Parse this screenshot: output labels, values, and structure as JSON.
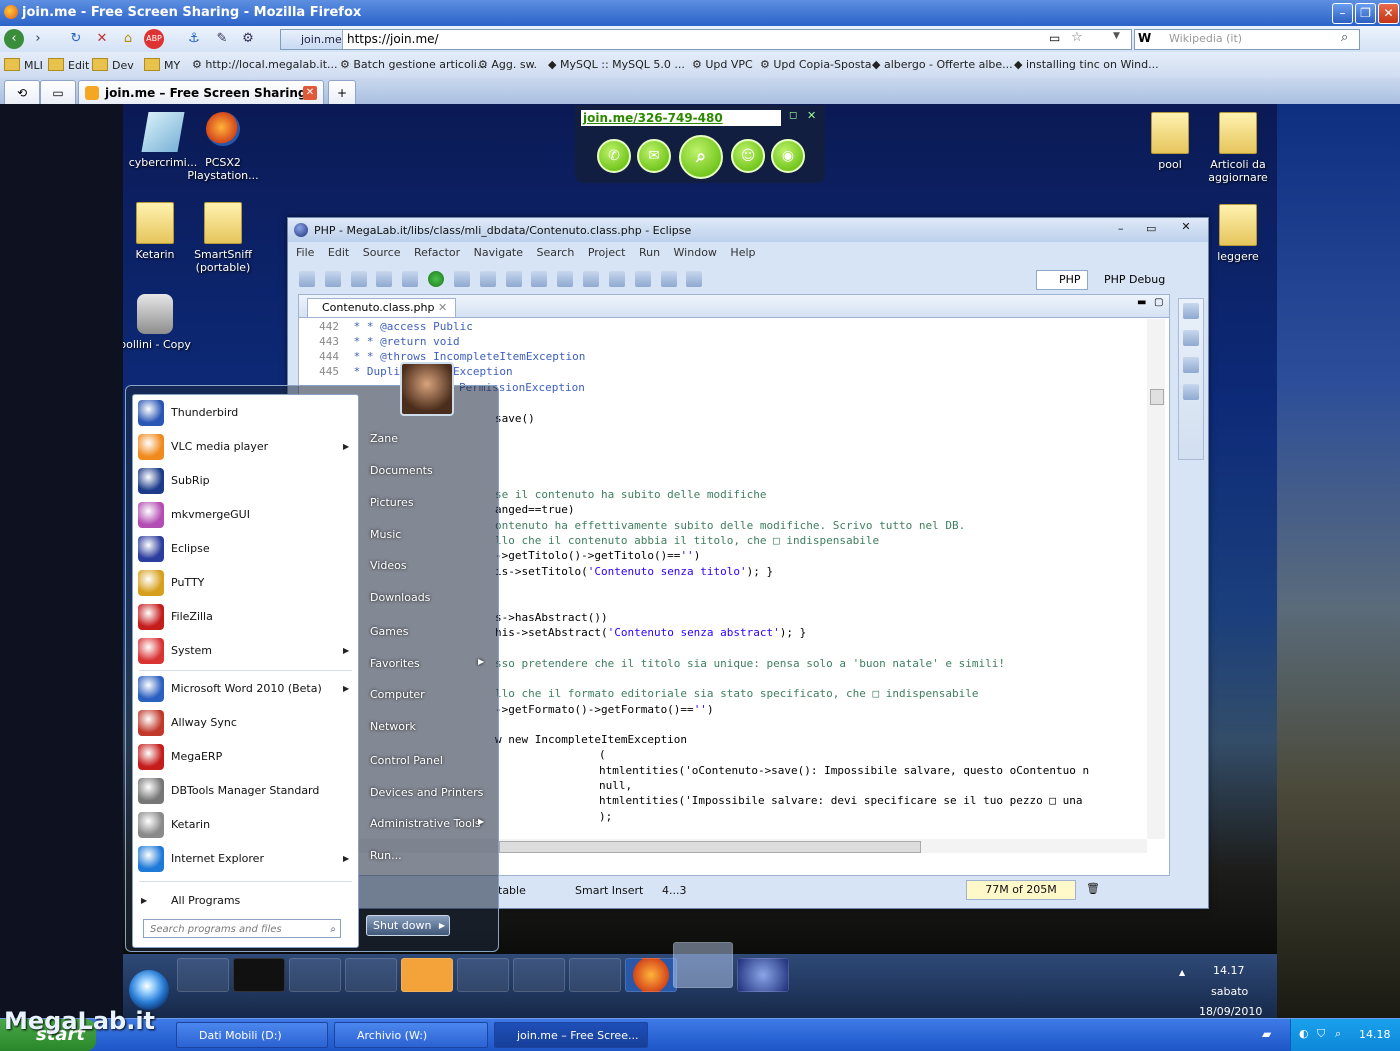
{
  "firefox": {
    "title": "join.me - Free Screen Sharing - Mozilla Firefox",
    "url_site": "join.me",
    "url": "https://join.me/",
    "search_placeholder": "Wikipedia (it)",
    "bookmarks": [
      "MLI",
      "Edit",
      "Dev",
      "MY",
      "http://local.megalab.it...",
      "Batch gestione articoli...",
      "Agg. sw.",
      "MySQL :: MySQL 5.0 ...",
      "Upd VPC",
      "Upd Copia-Sposta",
      "albergo - Offerte albe...",
      "installing tinc on Wind..."
    ],
    "tab_label": "join.me – Free Screen Sharing"
  },
  "joinme": {
    "code_url": "join.me/326-749-480"
  },
  "desktop_icons": {
    "cybercrimi": "cybercrimi...",
    "pcsx2": "PCSX2 Playstation...",
    "ketarin": "Ketarin",
    "smartsniff": "SmartSniff (portable)",
    "bollini": "bollini - Copy",
    "pool": "pool",
    "articoli": "Articoli da aggiornare",
    "leggere": "leggere"
  },
  "eclipse": {
    "title": "PHP - MegaLab.it/libs/class/mli_dbdata/Contenuto.class.php - Eclipse",
    "menu": [
      "File",
      "Edit",
      "Source",
      "Refactor",
      "Navigate",
      "Search",
      "Project",
      "Run",
      "Window",
      "Help"
    ],
    "perspective_php": "PHP",
    "perspective_debug": "PHP Debug",
    "editor_tab": "Contenuto.class.php",
    "code_lines": [
      {
        "n": "442",
        "text": "* @access Public"
      },
      {
        "n": "443",
        "text": "* @return void"
      },
      {
        "n": "444",
        "text": "* @throws IncompleteItemException"
      },
      {
        "n": "445",
        "text": "DuplicateItemException"
      },
      {
        "n": "",
        "text": "PermissionException"
      },
      {
        "n": "",
        "text": "save()"
      },
      {
        "n": "",
        "text": "se il contenuto ha subito delle modifiche"
      },
      {
        "n": "",
        "text": "anged==true)"
      },
      {
        "n": "",
        "text": "ontenuto ha effettivamente subito delle modifiche. Scrivo tutto nel DB."
      },
      {
        "n": "",
        "text": "llo che il contenuto abbia il titolo, che □ indispensabile"
      },
      {
        "n": "",
        "text": "->getTitolo()->getTitolo()=='')"
      },
      {
        "n": "",
        "text": "is->setTitolo('Contenuto senza titolo'); }"
      },
      {
        "n": "",
        "text": "s->hasAbstract())"
      },
      {
        "n": "",
        "text": "his->setAbstract('Contenuto senza abstract'); }"
      },
      {
        "n": "",
        "text": "sso pretendere che il titolo sia unique: pensa solo a 'buon natale' e simili!"
      },
      {
        "n": "",
        "text": "llo che il formato editoriale sia stato specificato, che □ indispensabile"
      },
      {
        "n": "",
        "text": "->getFormato()->getFormato()=='')"
      },
      {
        "n": "",
        "text": "w new IncompleteItemException"
      },
      {
        "n": "",
        "text": "("
      },
      {
        "n": "",
        "text": "htmlentities('oContenuto->save(): Impossibile salvare, questo oContentuo n"
      },
      {
        "n": "",
        "text": "null,"
      },
      {
        "n": "",
        "text": "htmlentities('Impossibile salvare: devi specificare se il tuo pezzo □ una"
      },
      {
        "n": "",
        "text": ");"
      }
    ],
    "status_writable": "table",
    "status_insert": "Smart Insert",
    "status_pos": "4...3",
    "status_memory": "77M of 205M"
  },
  "start_menu": {
    "programs": [
      {
        "label": "Thunderbird",
        "arrow": false
      },
      {
        "label": "VLC media player",
        "arrow": true
      },
      {
        "label": "SubRip",
        "arrow": false
      },
      {
        "label": "mkvmergeGUI",
        "arrow": false
      },
      {
        "label": "Eclipse",
        "arrow": false
      },
      {
        "label": "PuTTY",
        "arrow": false
      },
      {
        "label": "FileZilla",
        "arrow": false
      },
      {
        "label": "System",
        "arrow": true
      },
      {
        "label": "Microsoft Word 2010 (Beta)",
        "arrow": true
      },
      {
        "label": "Allway Sync",
        "arrow": false
      },
      {
        "label": "MegaERP",
        "arrow": false
      },
      {
        "label": "DBTools Manager Standard",
        "arrow": false
      },
      {
        "label": "Ketarin",
        "arrow": false
      },
      {
        "label": "Internet Explorer",
        "arrow": true
      }
    ],
    "all_programs": "All Programs",
    "search_placeholder": "Search programs and files",
    "right_links": [
      "Zane",
      "Documents",
      "Pictures",
      "Music",
      "Videos",
      "Downloads",
      "Games",
      "Favorites",
      "Computer",
      "Network",
      "Control Panel",
      "Devices and Printers",
      "Administrative Tools",
      "Run..."
    ],
    "shutdown": "Shut down"
  },
  "remote_clock": {
    "time": "14.17",
    "day": "sabato",
    "date": "18/09/2010"
  },
  "host_taskbar": {
    "start": "start",
    "logo_text": "MegaLab.it",
    "tasks": [
      "Dati Mobili (D:)",
      "Archivio (W:)",
      "join.me – Free Scree..."
    ],
    "clock": "14.18"
  },
  "colors": {
    "accent": "#2b63c8",
    "join_green": "#56b500"
  }
}
